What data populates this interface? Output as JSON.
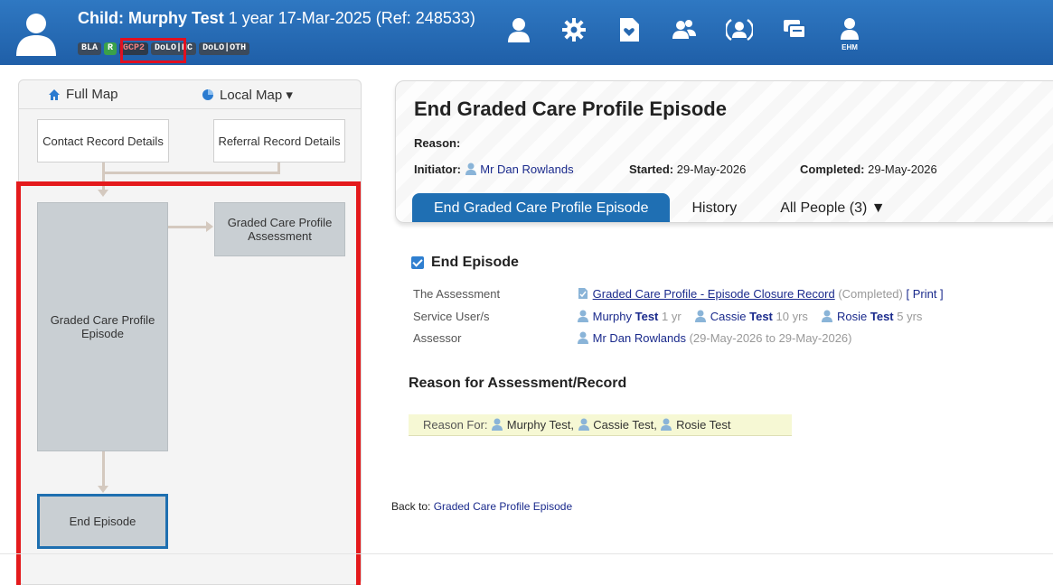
{
  "header": {
    "prefix": "Child:",
    "name": "Murphy Test",
    "details": "1 year 17-Mar-2025 (Ref: 248533)",
    "badges": [
      "BLA",
      "R",
      "GCP2",
      "DoLO|HC",
      "DoLO|OTH"
    ],
    "tools": [
      "person-icon",
      "gear-icon",
      "document-heart-icon",
      "people-icon",
      "contact-icon",
      "chat-icon",
      "ehm-person-icon"
    ],
    "ehm_label": "EHM"
  },
  "map": {
    "full_map": "Full Map",
    "local_map": "Local Map ▾",
    "contact_record": "Contact Record Details",
    "referral_record": "Referral Record Details",
    "gcp_assessment": "Graded Care Profile Assessment",
    "gcp_episode": "Graded Care Profile Episode",
    "end_episode": "End Episode"
  },
  "episode": {
    "title": "End Graded Care Profile Episode",
    "reason_label": "Reason:",
    "initiator_label": "Initiator:",
    "initiator": "Mr Dan Rowlands",
    "started_label": "Started:",
    "started": "29-May-2026",
    "completed_label": "Completed:",
    "completed": "29-May-2026",
    "tabs": [
      "End Graded Care Profile Episode",
      "History",
      "All People (3) ▼"
    ]
  },
  "end_episode": {
    "heading": "End Episode",
    "assessment_label": "The Assessment",
    "assessment_link": "Graded Care Profile - Episode Closure Record",
    "assessment_status": "(Completed)",
    "print": "[ Print ]",
    "service_users_label": "Service User/s",
    "users": [
      {
        "first": "Murphy",
        "last": "Test",
        "age": "1 yr"
      },
      {
        "first": "Cassie",
        "last": "Test",
        "age": "10 yrs"
      },
      {
        "first": "Rosie",
        "last": "Test",
        "age": "5 yrs"
      }
    ],
    "assessor_label": "Assessor",
    "assessor": "Mr Dan Rowlands",
    "assessor_dates": "(29-May-2026 to 29-May-2026)"
  },
  "reason": {
    "heading": "Reason for Assessment/Record",
    "label": "Reason For:",
    "people": [
      "Murphy Test,",
      "Cassie Test,",
      "Rosie Test"
    ]
  },
  "back": {
    "label": "Back to:",
    "link": "Graded Care Profile Episode"
  }
}
